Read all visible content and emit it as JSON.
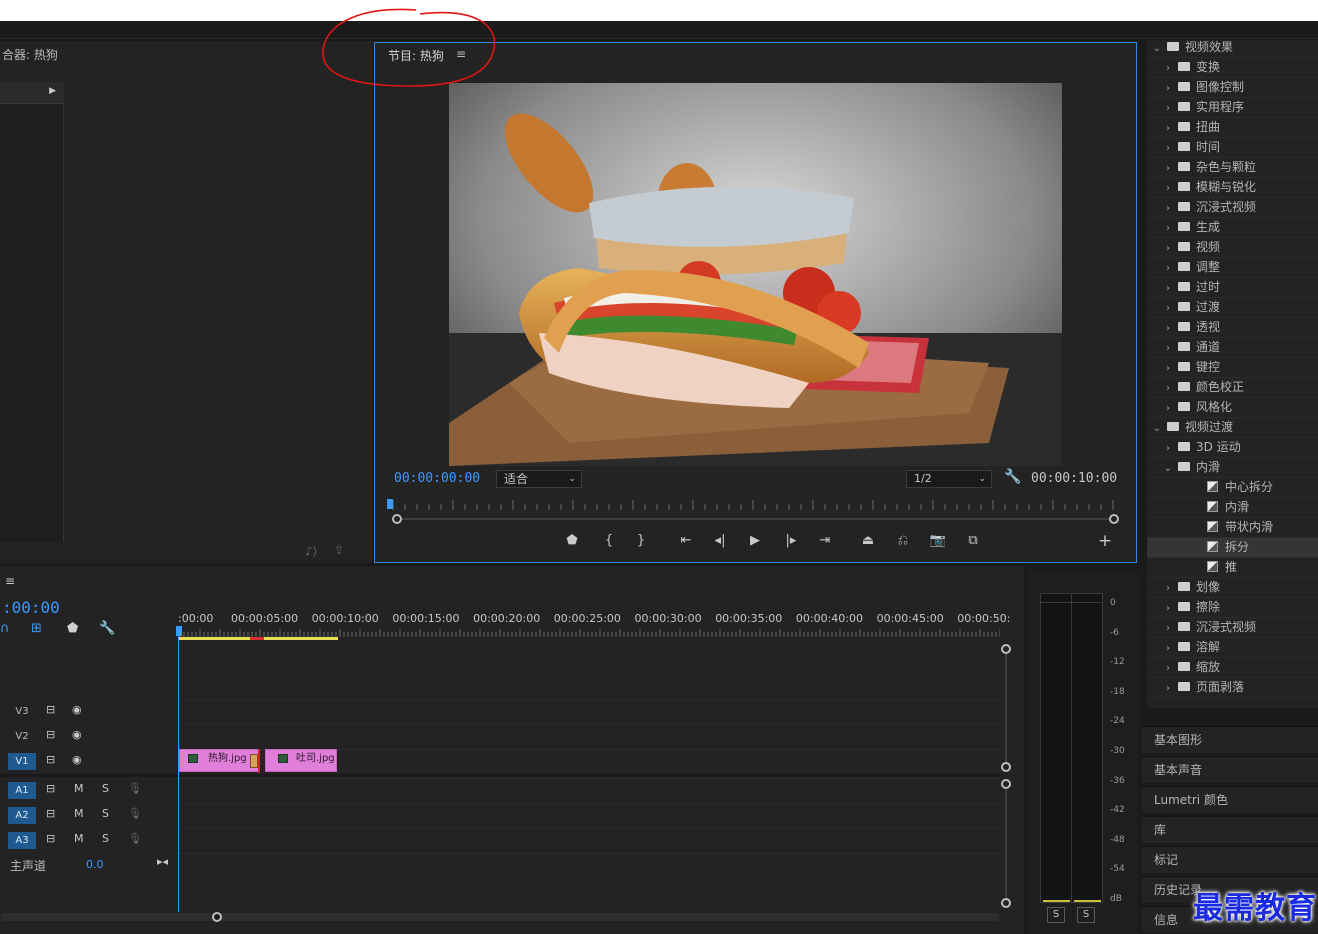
{
  "source_panel": {
    "title": "合器: 热狗"
  },
  "program_panel": {
    "title": "节目: 热狗",
    "menu_icon": "≡",
    "timecode": "00:00:00:00",
    "fit_label": "适合",
    "resolution": "1/2",
    "duration": "00:00:10:00"
  },
  "effects": {
    "items": [
      {
        "label": "视频效果",
        "level": 0,
        "type": "folder",
        "open": true
      },
      {
        "label": "变换",
        "level": 1,
        "type": "folder"
      },
      {
        "label": "图像控制",
        "level": 1,
        "type": "folder"
      },
      {
        "label": "实用程序",
        "level": 1,
        "type": "folder"
      },
      {
        "label": "扭曲",
        "level": 1,
        "type": "folder"
      },
      {
        "label": "时间",
        "level": 1,
        "type": "folder"
      },
      {
        "label": "杂色与颗粒",
        "level": 1,
        "type": "folder"
      },
      {
        "label": "模糊与锐化",
        "level": 1,
        "type": "folder"
      },
      {
        "label": "沉浸式视频",
        "level": 1,
        "type": "folder"
      },
      {
        "label": "生成",
        "level": 1,
        "type": "folder"
      },
      {
        "label": "视频",
        "level": 1,
        "type": "folder"
      },
      {
        "label": "调整",
        "level": 1,
        "type": "folder"
      },
      {
        "label": "过时",
        "level": 1,
        "type": "folder"
      },
      {
        "label": "过渡",
        "level": 1,
        "type": "folder"
      },
      {
        "label": "透视",
        "level": 1,
        "type": "folder"
      },
      {
        "label": "通道",
        "level": 1,
        "type": "folder"
      },
      {
        "label": "键控",
        "level": 1,
        "type": "folder"
      },
      {
        "label": "颜色校正",
        "level": 1,
        "type": "folder"
      },
      {
        "label": "风格化",
        "level": 1,
        "type": "folder"
      },
      {
        "label": "视频过渡",
        "level": 0,
        "type": "folder",
        "open": true
      },
      {
        "label": "3D 运动",
        "level": 1,
        "type": "folder"
      },
      {
        "label": "内滑",
        "level": 1,
        "type": "folder",
        "open": true
      },
      {
        "label": "中心拆分",
        "level": 2,
        "type": "effect"
      },
      {
        "label": "内滑",
        "level": 2,
        "type": "effect"
      },
      {
        "label": "带状内滑",
        "level": 2,
        "type": "effect"
      },
      {
        "label": "拆分",
        "level": 2,
        "type": "effect",
        "selected": true
      },
      {
        "label": "推",
        "level": 2,
        "type": "effect"
      },
      {
        "label": "划像",
        "level": 1,
        "type": "folder"
      },
      {
        "label": "擦除",
        "level": 1,
        "type": "folder"
      },
      {
        "label": "沉浸式视频",
        "level": 1,
        "type": "folder"
      },
      {
        "label": "溶解",
        "level": 1,
        "type": "folder"
      },
      {
        "label": "缩放",
        "level": 1,
        "type": "folder"
      },
      {
        "label": "页面剥落",
        "level": 1,
        "type": "folder"
      }
    ]
  },
  "side_panels": [
    "基本图形",
    "基本声音",
    "Lumetri 颜色",
    "库",
    "标记",
    "历史记录",
    "信息"
  ],
  "timeline": {
    "menu_icon": "≡",
    "timecode": ":00:00",
    "ruler": [
      ":00:00",
      "00:00:05:00",
      "00:00:10:00",
      "00:00:15:00",
      "00:00:20:00",
      "00:00:25:00",
      "00:00:30:00",
      "00:00:35:00",
      "00:00:40:00",
      "00:00:45:00",
      "00:00:50:"
    ],
    "video_tracks": [
      {
        "name": "V3",
        "active": false
      },
      {
        "name": "V2",
        "active": false
      },
      {
        "name": "V1",
        "active": true
      }
    ],
    "audio_tracks": [
      {
        "name": "A1",
        "m": "M",
        "s": "S"
      },
      {
        "name": "A2",
        "m": "M",
        "s": "S"
      },
      {
        "name": "A3",
        "m": "M",
        "s": "S"
      }
    ],
    "clips": [
      {
        "name": "热狗.jpg"
      },
      {
        "name": "吐司.jpg"
      }
    ],
    "master": {
      "label": "主声道",
      "value": "0.0"
    }
  },
  "meters": {
    "scale": [
      "0",
      "-6",
      "-12",
      "-18",
      "-24",
      "-30",
      "-36",
      "-42",
      "-48",
      "-54",
      "dB"
    ],
    "solo_buttons": [
      "S",
      "S"
    ]
  },
  "watermark": "最需教育",
  "colors": {
    "accent": "#2d8ceb",
    "timecode": "#3a9bff",
    "clip": "#e07fd9",
    "workarea": "#e6e055",
    "annotation": "#e01515"
  }
}
